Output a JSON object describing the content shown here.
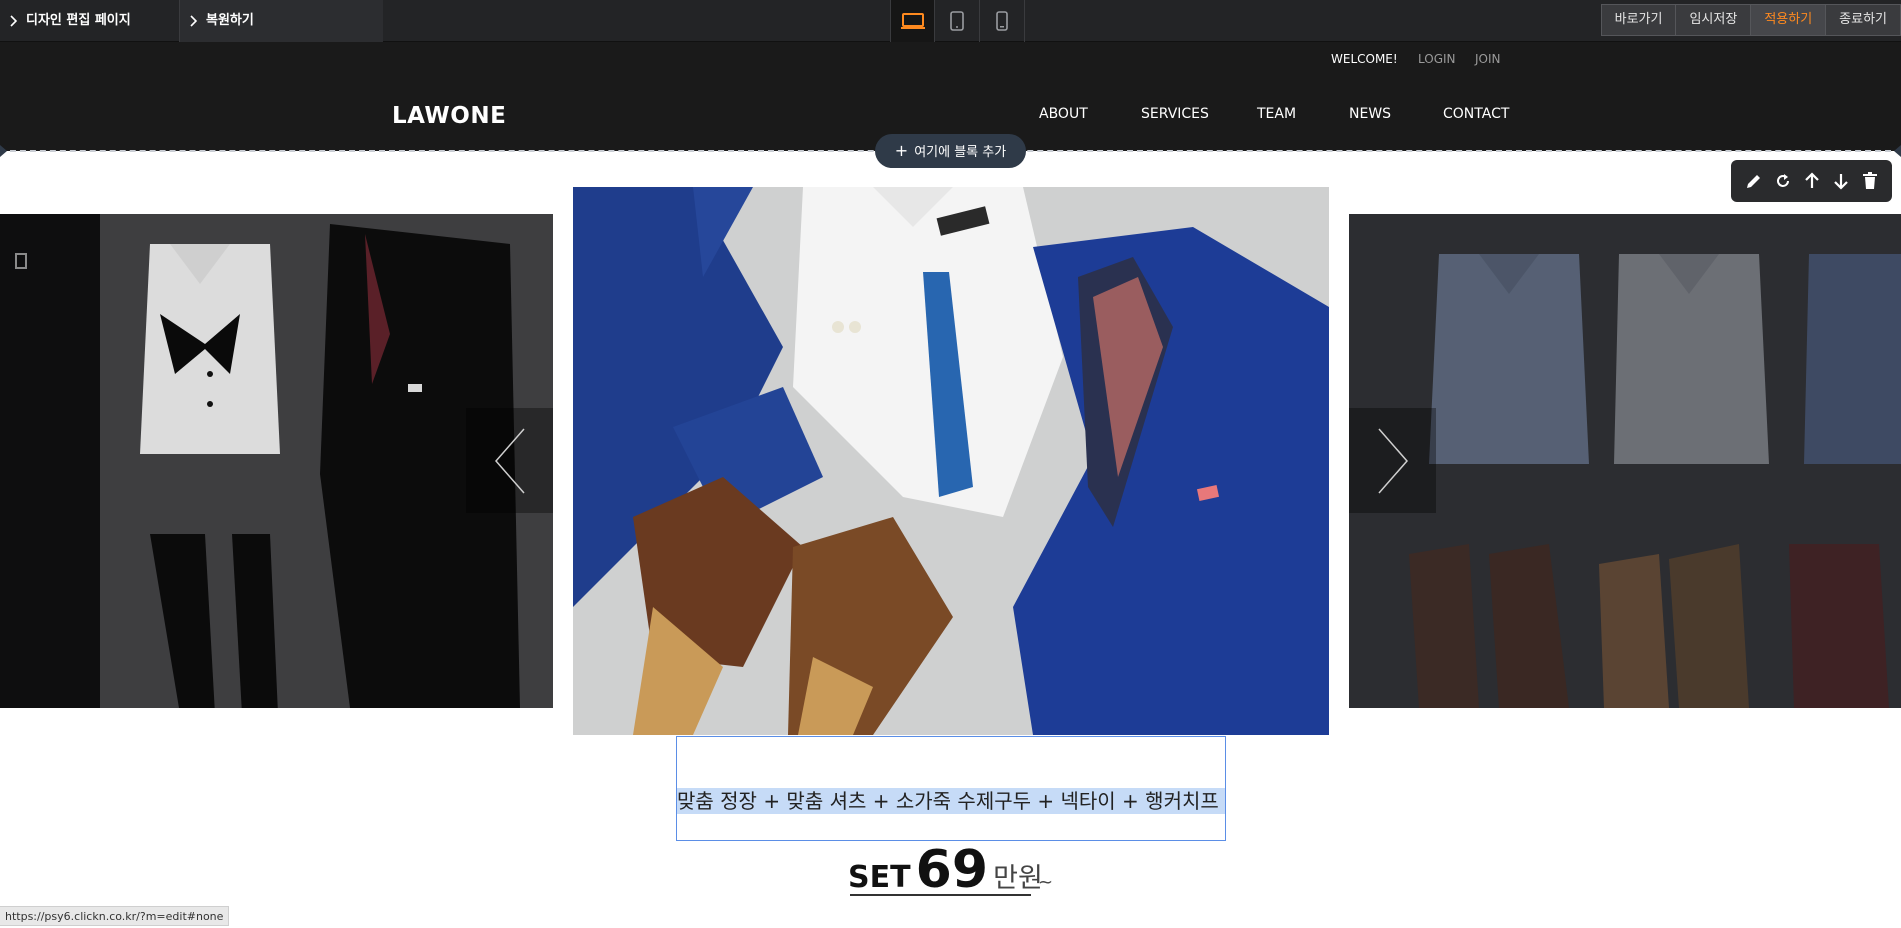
{
  "editor": {
    "design_edit_label": "디자인 편집 페이지",
    "restore_label": "복원하기",
    "devices": [
      "desktop-icon",
      "tablet-icon",
      "mobile-icon"
    ],
    "active_device_color": "#ff8a1f",
    "buttons": {
      "goto": "바로가기",
      "temp_save": "임시저장",
      "apply": "적용하기",
      "exit": "종료하기"
    },
    "accent_color": "#ff8a1f"
  },
  "header": {
    "welcome": "WELCOME!",
    "login": "LOGIN",
    "join": "JOIN",
    "logo": "LAWONE",
    "nav": [
      "ABOUT",
      "SERVICES",
      "TEAM",
      "NEWS",
      "CONTACT"
    ]
  },
  "add_block_label": "여기에 블록 추가",
  "block_tools": [
    "pencil-icon",
    "refresh-icon",
    "arrow-up-icon",
    "arrow-down-icon",
    "trash-icon"
  ],
  "slider": {
    "slides": [
      "tuxedo-flatlay",
      "blue-suit-flatlay",
      "shirts-and-boots-flatlay"
    ],
    "active_index": 1
  },
  "product": {
    "caption": "맞춤 정장 + 맞춤 셔츠 + 소가죽 수제구두 + 넥타이 + 행커치프",
    "price_prefix": "SET",
    "price_number": "69",
    "price_unit": "만원",
    "price_suffix": "~"
  },
  "status_url": "https://psy6.clickn.co.kr/?m=edit#none"
}
